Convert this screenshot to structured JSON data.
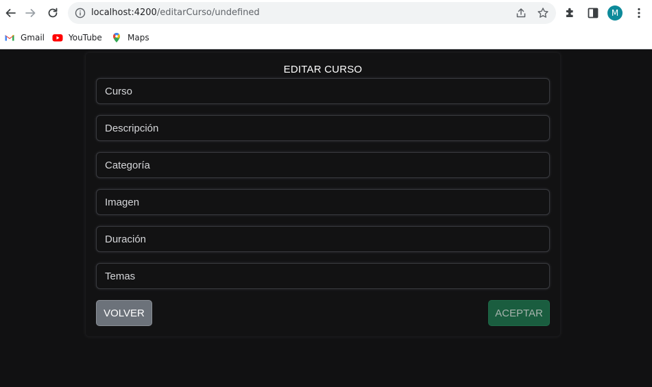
{
  "browser": {
    "url_host": "localhost:4200",
    "url_path": "/editarCurso/undefined",
    "avatar_letter": "M",
    "bookmarks": [
      {
        "label": "Gmail",
        "icon": "gmail-icon"
      },
      {
        "label": "YouTube",
        "icon": "youtube-icon"
      },
      {
        "label": "Maps",
        "icon": "maps-icon"
      }
    ]
  },
  "form": {
    "title": "EDITAR CURSO",
    "fields": [
      {
        "placeholder": "Curso"
      },
      {
        "placeholder": "Descripción"
      },
      {
        "placeholder": "Categoría"
      },
      {
        "placeholder": "Imagen"
      },
      {
        "placeholder": "Duración"
      },
      {
        "placeholder": "Temas"
      }
    ],
    "back_label": "VOLVER",
    "accept_label": "ACEPTAR"
  },
  "colors": {
    "page_bg": "#111112",
    "back_button": "#6c727a",
    "accept_button": "#1a5d3f"
  }
}
